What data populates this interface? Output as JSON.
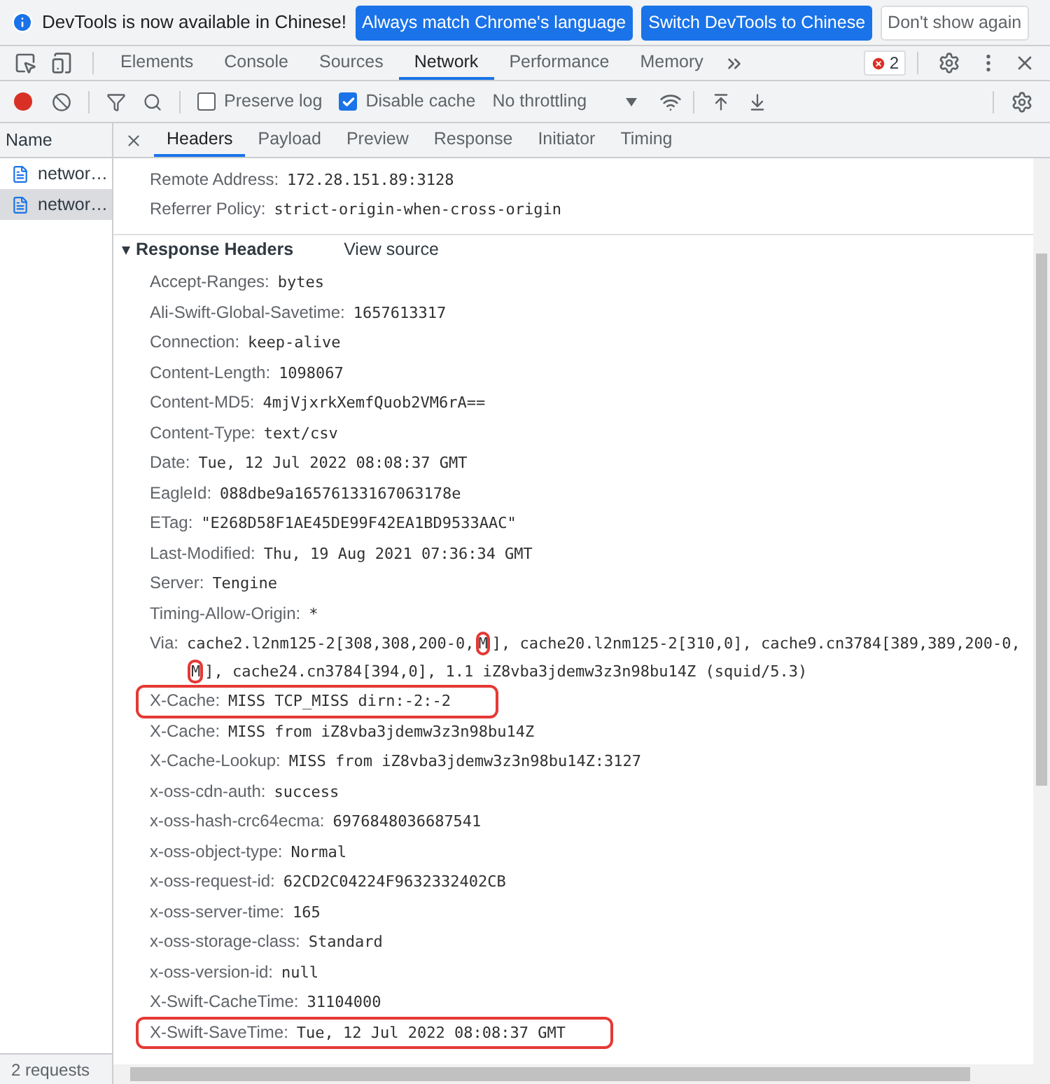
{
  "banner": {
    "message": "DevTools is now available in Chinese!",
    "buttons": [
      {
        "label": "Always match Chrome's language",
        "kind": "primary"
      },
      {
        "label": "Switch DevTools to Chinese",
        "kind": "primary"
      },
      {
        "label": "Don't show again",
        "kind": "secondary"
      }
    ]
  },
  "tabs": [
    {
      "label": "Elements",
      "selected": false
    },
    {
      "label": "Console",
      "selected": false
    },
    {
      "label": "Sources",
      "selected": false
    },
    {
      "label": "Network",
      "selected": true
    },
    {
      "label": "Performance",
      "selected": false
    },
    {
      "label": "Memory",
      "selected": false
    }
  ],
  "error_count": "2",
  "toolbar": {
    "recording": true,
    "preserve_log": {
      "label": "Preserve log",
      "checked": false
    },
    "disable_cache": {
      "label": "Disable cache",
      "checked": true
    },
    "throttling": "No throttling"
  },
  "requests": {
    "column": "Name",
    "items": [
      {
        "name": "networ…",
        "selected": false
      },
      {
        "name": "networ…",
        "selected": true
      }
    ],
    "footer": "2 requests"
  },
  "detail_tabs": [
    {
      "label": "Headers",
      "selected": true
    },
    {
      "label": "Payload",
      "selected": false
    },
    {
      "label": "Preview",
      "selected": false
    },
    {
      "label": "Response",
      "selected": false
    },
    {
      "label": "Initiator",
      "selected": false
    },
    {
      "label": "Timing",
      "selected": false
    }
  ],
  "general": [
    {
      "name": "Remote Address:",
      "value": "172.28.151.89:3128"
    },
    {
      "name": "Referrer Policy:",
      "value": "strict-origin-when-cross-origin"
    }
  ],
  "response_headers": {
    "title": "Response Headers",
    "expanded": true,
    "view_source": "View source",
    "headers": [
      {
        "name": "Accept-Ranges:",
        "value": "bytes",
        "highlighted": false
      },
      {
        "name": "Ali-Swift-Global-Savetime:",
        "value": "1657613317",
        "highlighted": false
      },
      {
        "name": "Connection:",
        "value": "keep-alive",
        "highlighted": false
      },
      {
        "name": "Content-Length:",
        "value": "1098067",
        "highlighted": false
      },
      {
        "name": "Content-MD5:",
        "value": "4mjVjxrkXemfQuob2VM6rA==",
        "highlighted": false
      },
      {
        "name": "Content-Type:",
        "value": "text/csv",
        "highlighted": false
      },
      {
        "name": "Date:",
        "value": "Tue, 12 Jul 2022 08:08:37 GMT",
        "highlighted": false
      },
      {
        "name": "EagleId:",
        "value": "088dbe9a16576133167063178e",
        "highlighted": false
      },
      {
        "name": "ETag:",
        "value": "\"E268D58F1AE45DE99F42EA1BD9533AAC\"",
        "highlighted": false
      },
      {
        "name": "Last-Modified:",
        "value": "Thu, 19 Aug 2021 07:36:34 GMT",
        "highlighted": false
      },
      {
        "name": "Server:",
        "value": "Tengine",
        "highlighted": false
      },
      {
        "name": "Timing-Allow-Origin:",
        "value": "*",
        "highlighted": false
      },
      {
        "name": "Via:",
        "highlighted": false,
        "segments": [
          {
            "text": "cache2.l2nm125-2[308,308,200-0,",
            "highlighted": false
          },
          {
            "text": "M",
            "highlighted": true
          },
          {
            "text": "], cache20.l2nm125-2[310,0], cache9.cn3784[389,389,200-0,",
            "highlighted": false
          },
          {
            "text": "M",
            "highlighted": true
          },
          {
            "text": "], cache24.cn3784[394,0], 1.1 iZ8vba3jdemw3z3n98bu14Z (squid/5.3)",
            "highlighted": false
          }
        ]
      },
      {
        "name": "X-Cache:",
        "value": "MISS TCP_MISS dirn:-2:-2",
        "highlighted": true
      },
      {
        "name": "X-Cache:",
        "value": "MISS from iZ8vba3jdemw3z3n98bu14Z",
        "highlighted": false
      },
      {
        "name": "X-Cache-Lookup:",
        "value": "MISS from iZ8vba3jdemw3z3n98bu14Z:3127",
        "highlighted": false
      },
      {
        "name": "x-oss-cdn-auth:",
        "value": "success",
        "highlighted": false
      },
      {
        "name": "x-oss-hash-crc64ecma:",
        "value": "6976848036687541",
        "highlighted": false
      },
      {
        "name": "x-oss-object-type:",
        "value": "Normal",
        "highlighted": false
      },
      {
        "name": "x-oss-request-id:",
        "value": "62CD2C04224F9632332402CB",
        "highlighted": false
      },
      {
        "name": "x-oss-server-time:",
        "value": "165",
        "highlighted": false
      },
      {
        "name": "x-oss-storage-class:",
        "value": "Standard",
        "highlighted": false
      },
      {
        "name": "x-oss-version-id:",
        "value": "null",
        "highlighted": false
      },
      {
        "name": "X-Swift-CacheTime:",
        "value": "31104000",
        "highlighted": false
      },
      {
        "name": "X-Swift-SaveTime:",
        "value": "Tue, 12 Jul 2022 08:08:37 GMT",
        "highlighted": true
      }
    ]
  }
}
